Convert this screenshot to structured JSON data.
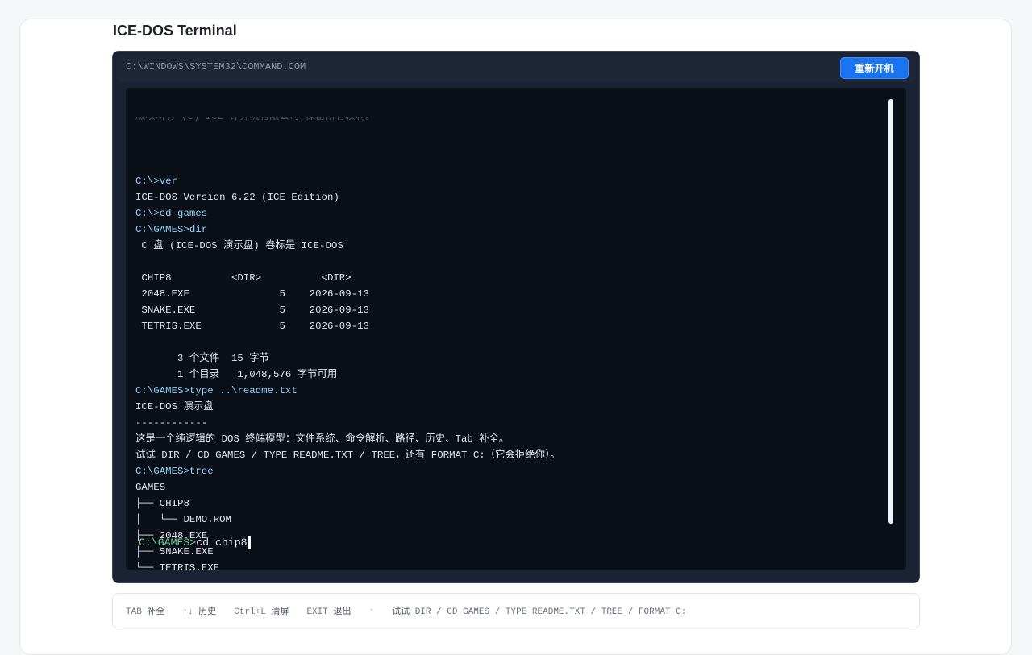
{
  "page": {
    "title": "ICE-DOS Terminal"
  },
  "window": {
    "path": "C:\\WINDOWS\\SYSTEM32\\COMMAND.COM",
    "reboot_label": "重新开机"
  },
  "terminal": {
    "clipped_top_line": "版权所有 (C) ICE 计算机有限公司 保留所有权利。",
    "lines": [
      {
        "text": "",
        "kind": "out"
      },
      {
        "text": "C:\\>ver",
        "kind": "cmd"
      },
      {
        "text": "ICE-DOS Version 6.22 (ICE Edition)",
        "kind": "out"
      },
      {
        "text": "C:\\>cd games",
        "kind": "cmd"
      },
      {
        "text": "C:\\GAMES>dir",
        "kind": "cmd"
      },
      {
        "text": " C 盘 (ICE-DOS 演示盘) 卷标是 ICE-DOS",
        "kind": "out"
      },
      {
        "text": "",
        "kind": "out"
      },
      {
        "text": " CHIP8          <DIR>          <DIR>",
        "kind": "out"
      },
      {
        "text": " 2048.EXE               5    2026-09-13",
        "kind": "out"
      },
      {
        "text": " SNAKE.EXE              5    2026-09-13",
        "kind": "out"
      },
      {
        "text": " TETRIS.EXE             5    2026-09-13",
        "kind": "out"
      },
      {
        "text": "",
        "kind": "out"
      },
      {
        "text": "       3 个文件  15 字节",
        "kind": "out"
      },
      {
        "text": "       1 个目录   1,048,576 字节可用",
        "kind": "out"
      },
      {
        "text": "C:\\GAMES>type ..\\readme.txt",
        "kind": "cmd"
      },
      {
        "text": "ICE-DOS 演示盘",
        "kind": "out"
      },
      {
        "text": "------------",
        "kind": "out"
      },
      {
        "text": "这是一个纯逻辑的 DOS 终端模型：文件系统、命令解析、路径、历史、Tab 补全。",
        "kind": "out"
      },
      {
        "text": "试试 DIR / CD GAMES / TYPE README.TXT / TREE，还有 FORMAT C:（它会拒绝你）。",
        "kind": "out"
      },
      {
        "text": "C:\\GAMES>tree",
        "kind": "cmd"
      },
      {
        "text": "GAMES",
        "kind": "out"
      },
      {
        "text": "├── CHIP8",
        "kind": "out"
      },
      {
        "text": "│   └── DEMO.ROM",
        "kind": "out"
      },
      {
        "text": "├── 2048.EXE",
        "kind": "out"
      },
      {
        "text": "├── SNAKE.EXE",
        "kind": "out"
      },
      {
        "text": "└── TETRIS.EXE",
        "kind": "out"
      }
    ],
    "input": {
      "prompt": "C:\\GAMES>",
      "value": "cd chip8"
    }
  },
  "hints": {
    "items": [
      {
        "key": "TAB",
        "label": "补全"
      },
      {
        "key": "↑↓",
        "label": "历史"
      },
      {
        "key": "Ctrl+L",
        "label": "清屏"
      },
      {
        "key": "EXIT",
        "label": "退出"
      }
    ],
    "separator": "·",
    "try_label": "试试",
    "try_commands": "DIR / CD GAMES / TYPE README.TXT / TREE / FORMAT C:"
  },
  "colors": {
    "command": "#8fd4ff",
    "input_prompt": "#6cd49b",
    "accent_button": "#1a73f0"
  }
}
